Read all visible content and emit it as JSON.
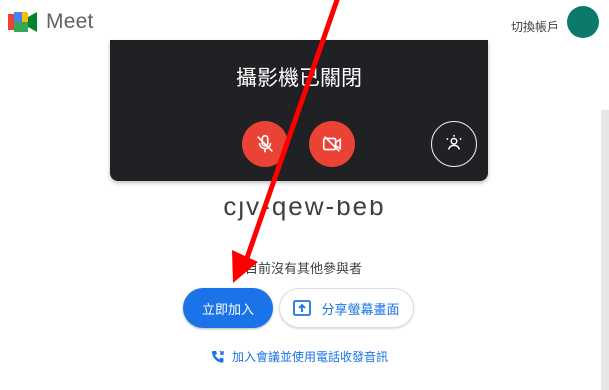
{
  "header": {
    "app_name": "Meet",
    "switch_account": "切換帳戶"
  },
  "preview": {
    "camera_status": "攝影機已關閉"
  },
  "meeting": {
    "code": "cjv-qew-beb",
    "participants_status": "目前沒有其他參與者"
  },
  "actions": {
    "join_label": "立即加入",
    "share_label": "分享螢幕畫面",
    "phone_label": "加入會議並使用電話收發音訊"
  },
  "colors": {
    "accent": "#1a73e8",
    "danger": "#ea4335",
    "annotation": "#ff0000"
  },
  "icons": [
    "meet-logo-icon",
    "mic-off-icon",
    "camera-off-icon",
    "effects-icon",
    "present-icon",
    "phone-icon"
  ]
}
